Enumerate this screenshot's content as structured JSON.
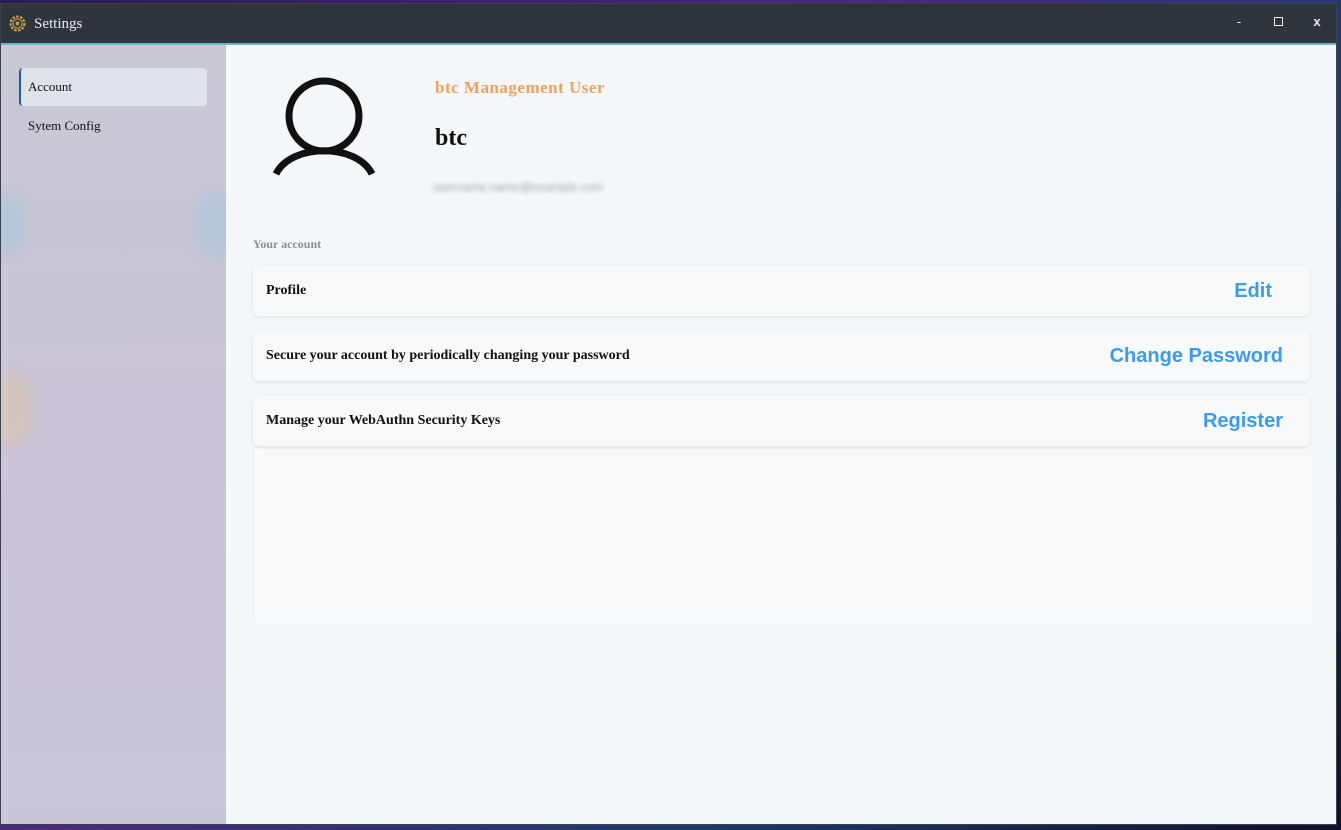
{
  "window": {
    "title": "Settings",
    "minimize_label": "-",
    "close_label": "x"
  },
  "sidebar": {
    "items": [
      {
        "label": "Account",
        "active": true
      },
      {
        "label": "Sytem Config",
        "active": false
      }
    ]
  },
  "profile": {
    "role": "btc Management User",
    "username": "btc",
    "email": "username.name@example.com"
  },
  "account": {
    "section_label": "Your account",
    "rows": [
      {
        "label": "Profile",
        "action": "Edit"
      },
      {
        "label": "Secure your account by periodically changing your password",
        "action": "Change Password"
      },
      {
        "label": "Manage your WebAuthn Security Keys",
        "action": "Register"
      }
    ]
  },
  "colors": {
    "accent": "#3d9be9",
    "role": "#f0a05a",
    "titlebar": "#2f353d"
  }
}
